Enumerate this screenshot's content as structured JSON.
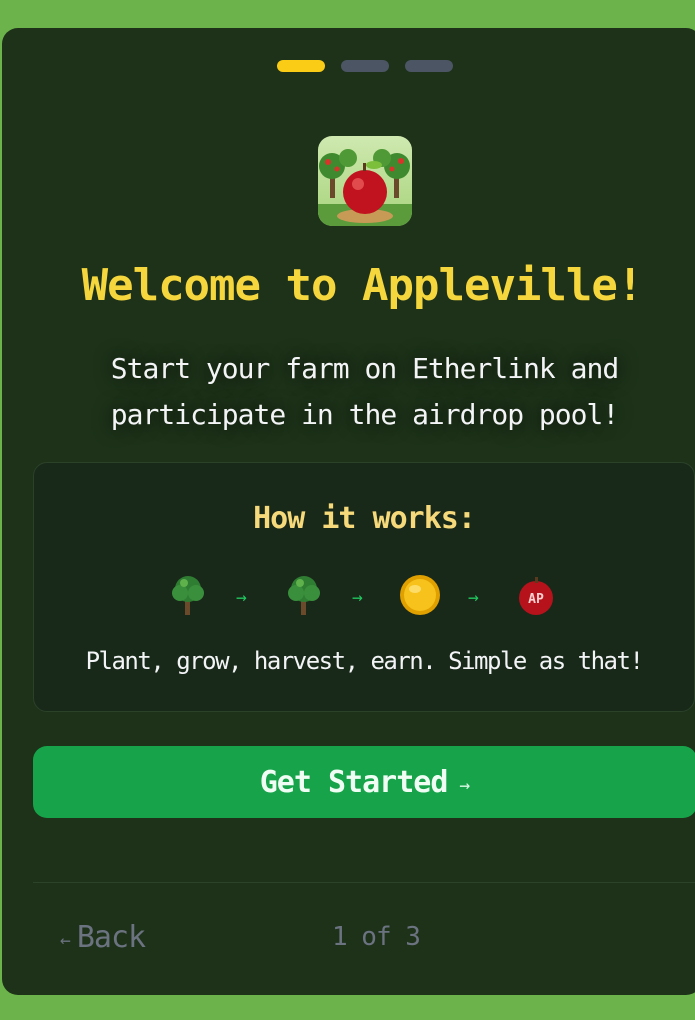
{
  "steps_indicator": {
    "total": 3,
    "active_index": 0
  },
  "logo": {
    "icon": "apple-orchard-icon"
  },
  "title": "Welcome to Appleville!",
  "subtitle": {
    "line1": "Start your farm on Etherlink and",
    "line2": "participate in the airdrop pool!"
  },
  "how_it_works": {
    "heading": "How it works:",
    "steps": [
      {
        "icon": "sapling-tree-icon",
        "label": "plant"
      },
      {
        "icon": "grown-tree-icon",
        "label": "grow"
      },
      {
        "icon": "gold-coin-icon",
        "label": "harvest"
      },
      {
        "icon": "ap-token-apple-icon",
        "label": "AP"
      }
    ],
    "arrow": "→",
    "description": "Plant, grow, harvest, earn. Simple as that!"
  },
  "cta": {
    "label": "Get Started",
    "arrow": "→"
  },
  "footer": {
    "back_arrow": "←",
    "back_label": "Back",
    "progress": "1 of 3"
  },
  "colors": {
    "page_bg": "#6bb34a",
    "card_bg": "#1d3219",
    "accent_yellow": "#facc15",
    "cta_green": "#16a34a",
    "muted": "#6b7280"
  }
}
